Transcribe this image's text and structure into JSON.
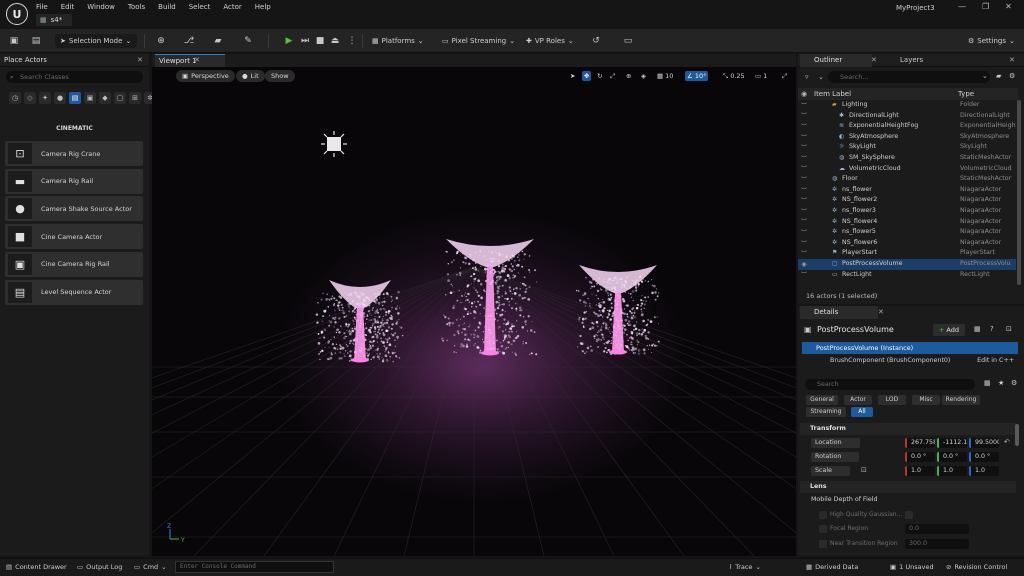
{
  "app": {
    "logo_text": "U",
    "menu": [
      "File",
      "Edit",
      "Window",
      "Tools",
      "Build",
      "Select",
      "Actor",
      "Help"
    ],
    "level_tab": "s4*",
    "project_name": "MyProject3",
    "window_controls": [
      "—",
      "❐",
      "✕"
    ]
  },
  "toolbar": {
    "selection_mode": "Selection Mode",
    "platforms": "Platforms",
    "pixel_streaming": "Pixel Streaming",
    "vp_roles": "VP Roles",
    "settings": "Settings"
  },
  "place_actors": {
    "tab_title": "Place Actors",
    "search_placeholder": "Search Classes",
    "category_title": "CINEMATIC",
    "items": [
      {
        "label": "Camera Rig Crane",
        "icon": "camera-rig-crane-icon",
        "glyph": "⊡"
      },
      {
        "label": "Camera Rig Rail",
        "icon": "camera-rig-rail-icon",
        "glyph": "▬"
      },
      {
        "label": "Camera Shake Source Actor",
        "icon": "camera-shake-sphere-icon",
        "glyph": "●"
      },
      {
        "label": "Cine Camera Actor",
        "icon": "cine-camera-icon",
        "glyph": "■"
      },
      {
        "label": "Cine Camera Rig Rail",
        "icon": "cine-camera-rig-rail-icon",
        "glyph": "▣"
      },
      {
        "label": "Level Sequence Actor",
        "icon": "clapperboard-icon",
        "glyph": "▤"
      }
    ]
  },
  "viewport": {
    "tab_title": "Viewport 1",
    "perspective": "Perspective",
    "lit": "Lit",
    "show": "Show",
    "grid_snap": "10",
    "rotation_snap": "10°",
    "scale_snap": "0.25",
    "camera_speed": "1",
    "gizmo_z": "Z",
    "gizmo_y": "Y"
  },
  "outliner": {
    "tab_title": "Outliner",
    "layers_tab": "Layers",
    "search_placeholder": "Search...",
    "col_label": "Item Label",
    "col_type": "Type",
    "rows": [
      {
        "label": "Lighting",
        "type": "Folder",
        "indent": 2,
        "icon": "folder-icon",
        "glyph": "▰",
        "selected": false
      },
      {
        "label": "DirectionalLight",
        "type": "DirectionalLight",
        "indent": 3,
        "icon": "directional-light-icon",
        "glyph": "✱",
        "selected": false
      },
      {
        "label": "ExponentialHeightFog",
        "type": "ExponentialHeightFog",
        "indent": 3,
        "icon": "fog-icon",
        "glyph": "≋",
        "selected": false
      },
      {
        "label": "SkyAtmosphere",
        "type": "SkyAtmosphere",
        "indent": 3,
        "icon": "sky-atmosphere-icon",
        "glyph": "◐",
        "selected": false
      },
      {
        "label": "SkyLight",
        "type": "SkyLight",
        "indent": 3,
        "icon": "sky-light-icon",
        "glyph": "☼",
        "selected": false
      },
      {
        "label": "SM_SkySphere",
        "type": "StaticMeshActor",
        "indent": 3,
        "icon": "static-mesh-icon",
        "glyph": "◍",
        "selected": false
      },
      {
        "label": "VolumetricCloud",
        "type": "VolumetricCloud",
        "indent": 3,
        "icon": "cloud-icon",
        "glyph": "☁",
        "selected": false
      },
      {
        "label": "Floor",
        "type": "StaticMeshActor",
        "indent": 2,
        "icon": "static-mesh-icon",
        "glyph": "◍",
        "selected": false
      },
      {
        "label": "ns_flower",
        "type": "NiagaraActor",
        "indent": 2,
        "icon": "niagara-icon",
        "glyph": "✲",
        "selected": false
      },
      {
        "label": "NS_flower2",
        "type": "NiagaraActor",
        "indent": 2,
        "icon": "niagara-icon",
        "glyph": "✲",
        "selected": false
      },
      {
        "label": "ns_flower3",
        "type": "NiagaraActor",
        "indent": 2,
        "icon": "niagara-icon",
        "glyph": "✲",
        "selected": false
      },
      {
        "label": "NS_flower4",
        "type": "NiagaraActor",
        "indent": 2,
        "icon": "niagara-icon",
        "glyph": "✲",
        "selected": false
      },
      {
        "label": "ns_flower5",
        "type": "NiagaraActor",
        "indent": 2,
        "icon": "niagara-icon",
        "glyph": "✲",
        "selected": false
      },
      {
        "label": "NS_flower6",
        "type": "NiagaraActor",
        "indent": 2,
        "icon": "niagara-icon",
        "glyph": "✲",
        "selected": false
      },
      {
        "label": "PlayerStart",
        "type": "PlayerStart",
        "indent": 2,
        "icon": "player-start-icon",
        "glyph": "⚑",
        "selected": false
      },
      {
        "label": "PostProcessVolume",
        "type": "PostProcessVolu",
        "indent": 2,
        "icon": "post-process-volume-icon",
        "glyph": "▢",
        "selected": true
      },
      {
        "label": "RectLight",
        "type": "RectLight",
        "indent": 2,
        "icon": "rect-light-icon",
        "glyph": "▭",
        "selected": false
      }
    ],
    "footer": "16 actors (1 selected)"
  },
  "details": {
    "tab_title": "Details",
    "object_name": "PostProcessVolume",
    "add_label": "Add",
    "instance_row": "PostProcessVolume (Instance)",
    "component_row": "BrushComponent (BrushComponent0)",
    "edit_cpp": "Edit in C++",
    "search_placeholder": "Search",
    "filters": [
      "General",
      "Actor",
      "LOD",
      "Misc",
      "Rendering",
      "Streaming",
      "All"
    ],
    "transform_section": "Transform",
    "location_label": "Location",
    "location": [
      "267.758·",
      "-1112.1€",
      "99.5000·"
    ],
    "rotation_label": "Rotation",
    "rotation": [
      "0.0 °",
      "0.0 °",
      "0.0 °"
    ],
    "scale_label": "Scale",
    "scale": [
      "1.0",
      "1.0",
      "1.0"
    ],
    "lens_section": "Lens",
    "mobile_dof_section": "Mobile Depth of Field",
    "hq_gaussian": "High Quality Gaussian...",
    "focal_region": "Focal Region",
    "focal_region_value": "0.0",
    "near_transition": "Near Transition Region",
    "near_transition_value": "300.0"
  },
  "statusbar": {
    "content_drawer": "Content Drawer",
    "output_log": "Output Log",
    "cmd": "Cmd",
    "console_placeholder": "Enter Console Command",
    "trace": "Trace",
    "derived_data": "Derived Data",
    "unsaved": "1 Unsaved",
    "revision_control": "Revision Control"
  },
  "colors": {
    "accent": "#1d5a9e",
    "play_green": "#5cbf3c",
    "panel_bg": "#1b1b1b",
    "flower_glow": "#ff9cf0"
  }
}
